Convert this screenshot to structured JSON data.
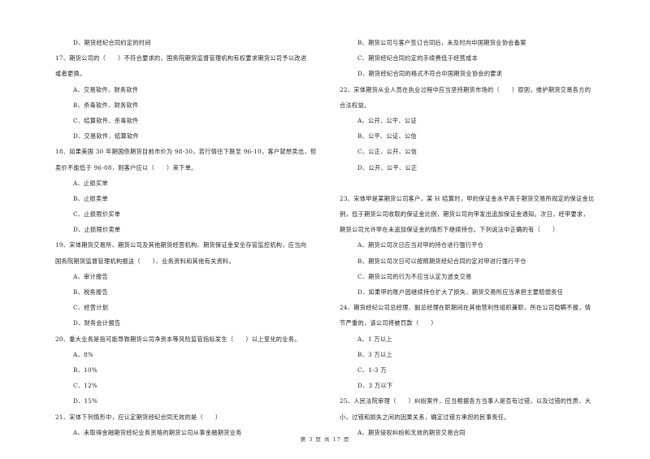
{
  "page": {
    "footer": "第 3 页 共 17 页"
  },
  "left_column": [
    {
      "type": "opt",
      "text": "D、期货经纪合同约定的时间"
    },
    {
      "type": "q",
      "text": "17、期货公司的（　　）不符合要求的，国务院期货监督管理机构有权要求期货公司予以改进"
    },
    {
      "type": "q",
      "text": "或者更换。"
    },
    {
      "type": "opt",
      "text": "A、交易软件、财务软件"
    },
    {
      "type": "opt",
      "text": "B、杀毒软件、财务软件"
    },
    {
      "type": "opt",
      "text": "C、结算软件、杀毒软件"
    },
    {
      "type": "opt",
      "text": "D、交易软件、结算软件"
    },
    {
      "type": "q",
      "text": "18、如果美国 30 年期国债期货目前市价为 98-30，若行情往下跌至 96-10，客户就想卖出，但"
    },
    {
      "type": "q",
      "text": "卖价不能低于 96-08，则客户应以（　　）来下单。"
    },
    {
      "type": "opt",
      "text": "A、止损买单"
    },
    {
      "type": "opt",
      "text": "B、止损卖单"
    },
    {
      "type": "opt",
      "text": "C、止损限价买单"
    },
    {
      "type": "opt",
      "text": "D、止损限价卖单"
    },
    {
      "type": "q",
      "text": "19、宋体期货交易所、期货公司及其他期货经营机构、期货保证金安全存管监控机构，应当向"
    },
    {
      "type": "q",
      "text": "国务院期货监督管理机构报送（　　）、业务资料和其他有关资料。"
    },
    {
      "type": "opt",
      "text": "A、审计报告"
    },
    {
      "type": "opt",
      "text": "B、税务报告"
    },
    {
      "type": "opt",
      "text": "C、经营计划"
    },
    {
      "type": "opt",
      "text": "D、财务会计报告"
    },
    {
      "type": "q",
      "text": "20、重大业务是指可能导致期货公司净资本等风险监管指标发生（　　）以上变化的业务。"
    },
    {
      "type": "opt",
      "text": "A、8%"
    },
    {
      "type": "opt",
      "text": "B、10%"
    },
    {
      "type": "opt",
      "text": "C、12%"
    },
    {
      "type": "opt",
      "text": "D、15%"
    },
    {
      "type": "q",
      "text": "21、宋体下列情形中，应认定期货经纪合同无效的是（　　）"
    },
    {
      "type": "opt",
      "text": "A、未取得金融期货经纪业务资格的期货公司从事金融期货业务"
    }
  ],
  "right_column": [
    {
      "type": "opt",
      "text": "B、期货公司与客户签订合同后，未及时向中国期货业协会备案"
    },
    {
      "type": "opt",
      "text": "C、期货经纪合同约定的手续费低于经营成本"
    },
    {
      "type": "opt",
      "text": "D、期货经纪合同的格式不符合中国期货业协会的要求"
    },
    {
      "type": "q",
      "text": "22、宋体期货从业人员在执业过程中应当坚持期货市场的（　　）原则，维护期货交易各方的"
    },
    {
      "type": "q",
      "text": "合法权益。"
    },
    {
      "type": "opt",
      "text": "A、公开、公平、公证"
    },
    {
      "type": "opt",
      "text": "B、公平、公证、公信"
    },
    {
      "type": "opt",
      "text": "C、公正、公开、公信"
    },
    {
      "type": "opt",
      "text": "D、公开、公平、公正"
    },
    {
      "type": "blank",
      "text": ""
    },
    {
      "type": "q",
      "text": "23、宋体甲是某期货公司客户，某 H 结算时，甲的保证金水平高于期货交易所规定的保证金比"
    },
    {
      "type": "q",
      "text": "例，低于期货公司收取的保证金比例，期货公司向甲发出追加保证金通知。次日，经甲要求，"
    },
    {
      "type": "q",
      "text": "期货公司允许甲在未追加保证金的情形下继续持仓。下列说法中正确的有（　　）"
    },
    {
      "type": "opt",
      "text": "A、期货公司次日应当对甲的持仓进行强行平仓"
    },
    {
      "type": "opt",
      "text": "B、期货公司次日可以按照期货经纪合同约定对甲进行强行平仓"
    },
    {
      "type": "opt",
      "text": "C、期货公司的行为不应当认定为透支交易"
    },
    {
      "type": "opt",
      "text": "D、如果甲的账户因继续持仓扩大了损失，期货交易所应当承担主要赔偿责任"
    },
    {
      "type": "q",
      "text": "24、期货经纪公司总经理、副总经理在职期间在其他营利性组织兼职，所在公司隐瞒不报，情"
    },
    {
      "type": "q",
      "text": "节严重的，该公司将被罚款（　　）"
    },
    {
      "type": "opt",
      "text": "A、1 万以上"
    },
    {
      "type": "opt",
      "text": "B、3 万以上"
    },
    {
      "type": "opt",
      "text": "C、1-3 万"
    },
    {
      "type": "opt",
      "text": "D、3 万以下"
    },
    {
      "type": "q",
      "text": "25、人民法院审理（　　）纠纷案件，应当根据各方当事人是否有过错，以及过错的性质、大"
    },
    {
      "type": "q",
      "text": "小，过错和损失之间的因果关系，确定过错方承担的民事责任。"
    },
    {
      "type": "opt",
      "text": "A、期货侵权纠纷和无效的期货交易合同"
    }
  ]
}
